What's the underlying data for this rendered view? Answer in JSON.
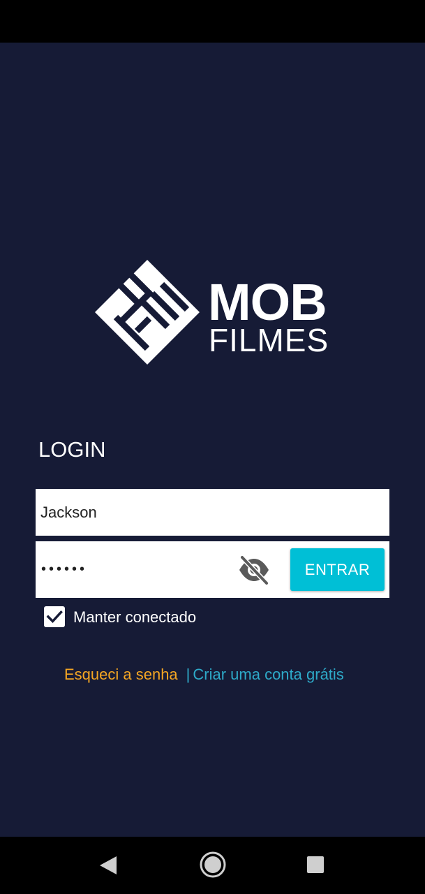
{
  "brand": {
    "line1": "MOB",
    "line2": "FILMES"
  },
  "login": {
    "title": "LOGIN",
    "username_value": "Jackson",
    "password_value": "••••••",
    "enter_label": "ENTRAR",
    "keep_connected_label": "Manter conectado",
    "keep_connected_checked": true
  },
  "links": {
    "forgot": "Esqueci a senha",
    "separator": "|",
    "create": "Criar uma conta grátis"
  },
  "icons": {
    "eye": "eye-off-icon",
    "check": "check-icon",
    "back": "back-triangle-icon",
    "home": "home-circle-icon",
    "recents": "recents-square-icon"
  },
  "colors": {
    "background": "#161b36",
    "accent": "#00bfd6",
    "forgot_link": "#f5a623",
    "create_link": "#2eaac9"
  }
}
